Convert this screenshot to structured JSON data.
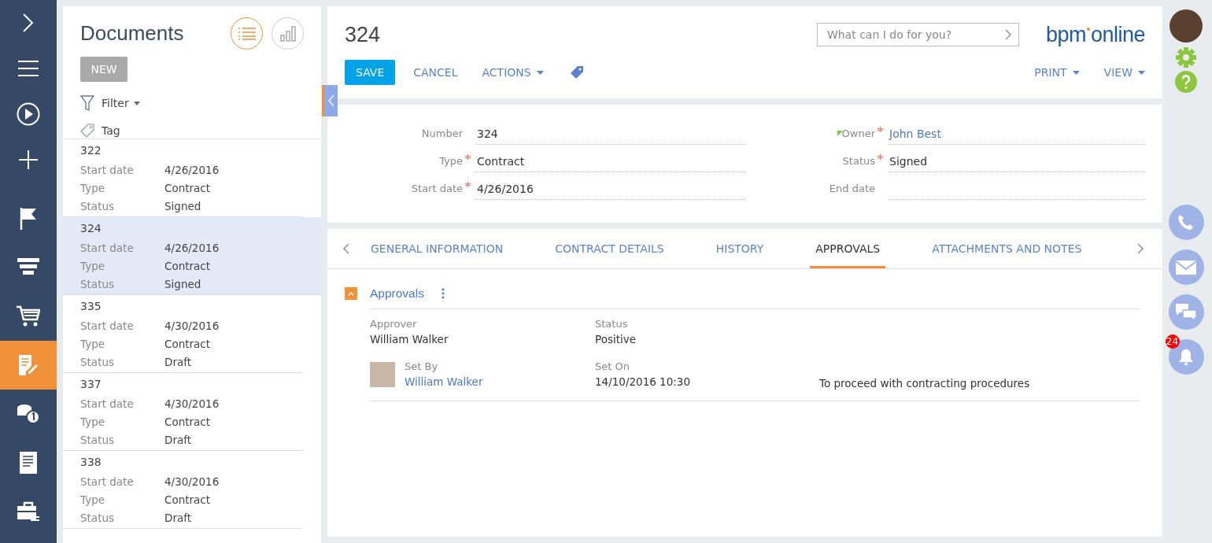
{
  "nav": [
    {
      "kind": "chevron",
      "selected": false
    },
    {
      "kind": "menu",
      "selected": false
    },
    {
      "kind": "play",
      "selected": false
    },
    {
      "kind": "plus",
      "selected": false
    },
    {
      "kind": "flag",
      "selected": false
    },
    {
      "kind": "funnel",
      "selected": false
    },
    {
      "kind": "cart",
      "selected": false
    },
    {
      "kind": "document-pen",
      "selected": true
    },
    {
      "kind": "coins",
      "selected": false
    },
    {
      "kind": "document",
      "selected": false
    },
    {
      "kind": "briefcase",
      "selected": false
    }
  ],
  "list": {
    "title": "Documents",
    "view_modes": [
      {
        "kind": "list",
        "selected": true
      },
      {
        "kind": "chart",
        "selected": false
      }
    ],
    "new_button": "NEW",
    "filter": "Filter",
    "tag": "Tag",
    "rows": [
      {
        "number": "322",
        "fields": [
          {
            "label": "Start date",
            "value": "4/26/2016"
          },
          {
            "label": "Type",
            "value": "Contract"
          },
          {
            "label": "Status",
            "value": "Signed"
          }
        ],
        "selected": false
      },
      {
        "number": "324",
        "fields": [
          {
            "label": "Start date",
            "value": "4/26/2016"
          },
          {
            "label": "Type",
            "value": "Contract"
          },
          {
            "label": "Status",
            "value": "Signed"
          }
        ],
        "selected": true
      },
      {
        "number": "335",
        "fields": [
          {
            "label": "Start date",
            "value": "4/30/2016"
          },
          {
            "label": "Type",
            "value": "Contract"
          },
          {
            "label": "Status",
            "value": "Draft"
          }
        ],
        "selected": false
      },
      {
        "number": "337",
        "fields": [
          {
            "label": "Start date",
            "value": "4/30/2016"
          },
          {
            "label": "Type",
            "value": "Contract"
          },
          {
            "label": "Status",
            "value": "Draft"
          }
        ],
        "selected": false
      },
      {
        "number": "338",
        "fields": [
          {
            "label": "Start date",
            "value": "4/30/2016"
          },
          {
            "label": "Type",
            "value": "Contract"
          },
          {
            "label": "Status",
            "value": "Draft"
          }
        ],
        "selected": false
      }
    ]
  },
  "header": {
    "title": "324",
    "search": {
      "placeholder": "What can I do for you?"
    },
    "logo": {
      "left": "bpm",
      "right": "online"
    },
    "buttons": [
      {
        "label": "SAVE",
        "kind": "primary"
      },
      {
        "label": "CANCEL",
        "kind": "link"
      },
      {
        "label": "ACTIONS",
        "kind": "menu"
      }
    ],
    "right_buttons": [
      {
        "label": "PRINT"
      },
      {
        "label": "VIEW"
      }
    ]
  },
  "fields": {
    "left": [
      {
        "label": "Number",
        "value": "324",
        "required": false,
        "link": false
      },
      {
        "label": "Type",
        "value": "Contract",
        "required": true,
        "link": false
      },
      {
        "label": "Start date",
        "value": "4/26/2016",
        "required": true,
        "link": false
      }
    ],
    "right": [
      {
        "label": "Owner",
        "value": "John Best",
        "required": true,
        "link": true
      },
      {
        "label": "Status",
        "value": "Signed",
        "required": true,
        "link": false
      },
      {
        "label": "End date",
        "required": false,
        "link": false
      }
    ]
  },
  "tabs": [
    {
      "label": "GENERAL INFORMATION",
      "selected": false
    },
    {
      "label": "CONTRACT DETAILS",
      "selected": false
    },
    {
      "label": "HISTORY",
      "selected": false
    },
    {
      "label": "APPROVALS",
      "selected": true
    },
    {
      "label": "ATTACHMENTS AND NOTES",
      "selected": false
    }
  ],
  "approvals": {
    "title": "Approvals",
    "expanded": true,
    "approver_label": "Approver",
    "approver": "William Walker",
    "status_label": "Status",
    "status": "Positive",
    "set_by_label": "Set By",
    "set_by": "William Walker",
    "set_on_label": "Set On",
    "set_on": "14/10/2016 10:30",
    "comment": "To proceed with contracting procedures"
  },
  "sidebar": {
    "notifications": "24"
  }
}
